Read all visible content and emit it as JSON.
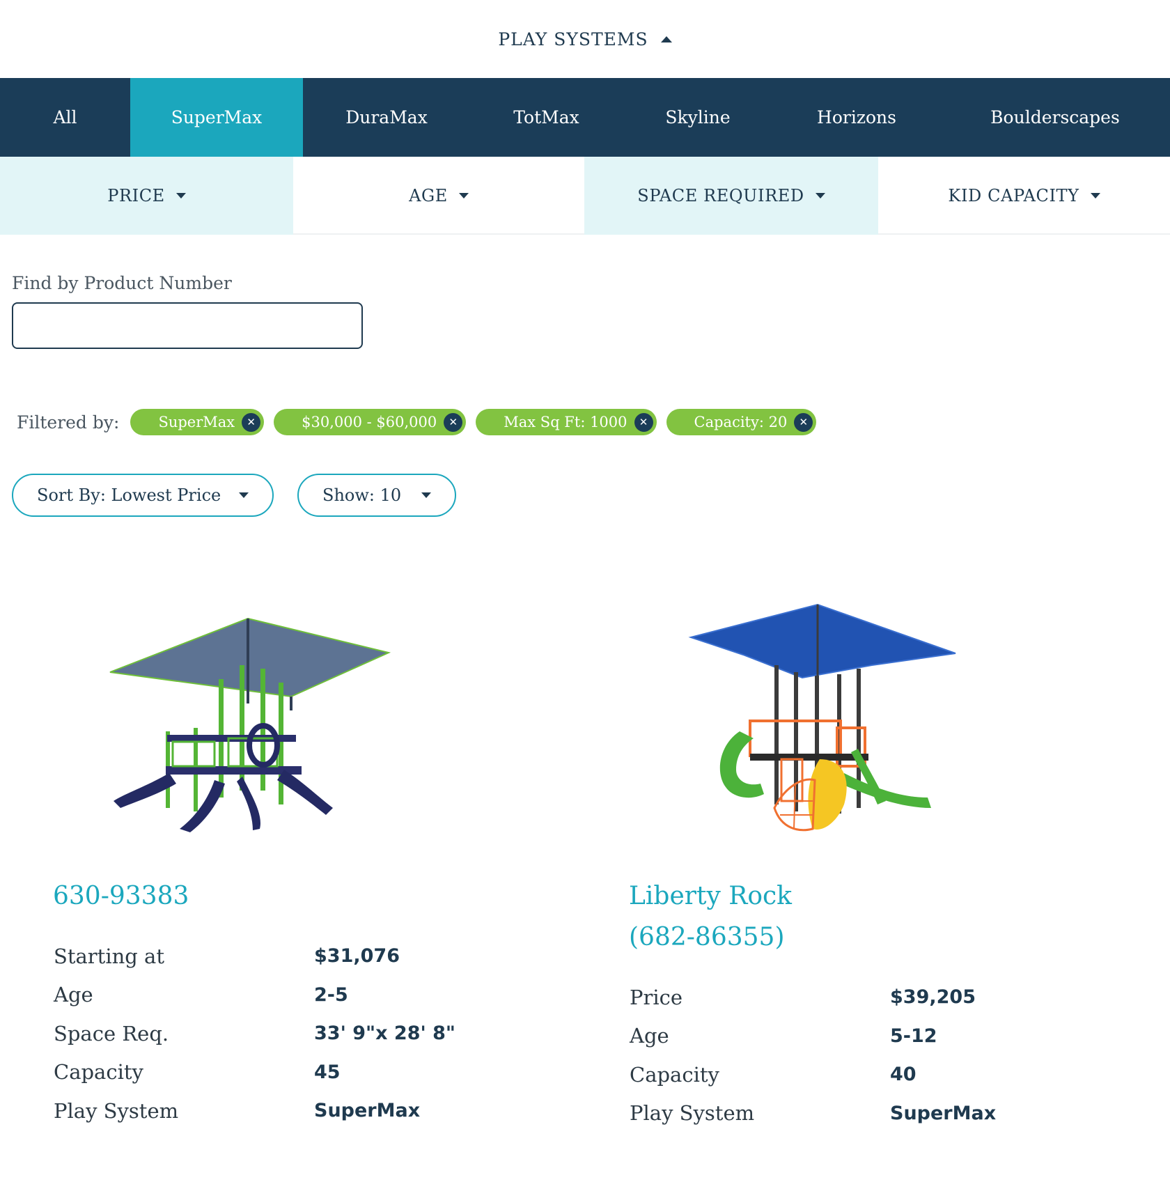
{
  "header": {
    "title": "PLAY SYSTEMS"
  },
  "tabs": [
    {
      "label": "All"
    },
    {
      "label": "SuperMax"
    },
    {
      "label": "DuraMax"
    },
    {
      "label": "TotMax"
    },
    {
      "label": "Skyline"
    },
    {
      "label": "Horizons"
    },
    {
      "label": "Boulderscapes"
    }
  ],
  "filters": [
    {
      "label": "PRICE"
    },
    {
      "label": "AGE"
    },
    {
      "label": "SPACE REQUIRED"
    },
    {
      "label": "KID CAPACITY"
    }
  ],
  "search": {
    "label": "Find by Product Number",
    "value": "",
    "placeholder": ""
  },
  "filtered_by": {
    "label": "Filtered by:",
    "chips": [
      {
        "label": "SuperMax"
      },
      {
        "label": "$30,000 - $60,000"
      },
      {
        "label": "Max Sq Ft: 1000"
      },
      {
        "label": "Capacity: 20"
      }
    ]
  },
  "sort": {
    "label": "Sort By: Lowest Price"
  },
  "show": {
    "label": "Show: 10"
  },
  "products": [
    {
      "title_line1": "630-93383",
      "title_line2": "",
      "specs": [
        {
          "label": "Starting at",
          "value": "$31,076"
        },
        {
          "label": "Age",
          "value": "2-5"
        },
        {
          "label": "Space Req.",
          "value": "33' 9\"x 28' 8\""
        },
        {
          "label": "Capacity",
          "value": "45"
        },
        {
          "label": "Play System",
          "value": "SuperMax"
        }
      ]
    },
    {
      "title_line1": "Liberty Rock",
      "title_line2": "(682-86355)",
      "specs": [
        {
          "label": "Price",
          "value": "$39,205"
        },
        {
          "label": "Age",
          "value": "5-12"
        },
        {
          "label": "Capacity",
          "value": "40"
        },
        {
          "label": "Play System",
          "value": "SuperMax"
        }
      ]
    }
  ],
  "colors": {
    "navy": "#1b3d58",
    "teal": "#1ba7bd",
    "light_teal": "#e2f5f7",
    "chip_green": "#82c341"
  }
}
